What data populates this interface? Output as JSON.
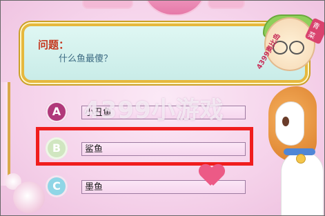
{
  "question": {
    "label": "问题：",
    "text": "什么鱼最傻？"
  },
  "options": [
    {
      "letter": "A",
      "text": "小丑鱼",
      "color": "#b0397a"
    },
    {
      "letter": "B",
      "text": "鲨鱼",
      "color": "#d0e6c0",
      "highlighted": true
    },
    {
      "letter": "C",
      "text": "墨鱼",
      "color": "#8fd6e6"
    }
  ],
  "watermark": "4399小游戏",
  "badge": {
    "text": "4399奥比岛",
    "tag": "青菜"
  },
  "highlight_color": "#f01d1d"
}
